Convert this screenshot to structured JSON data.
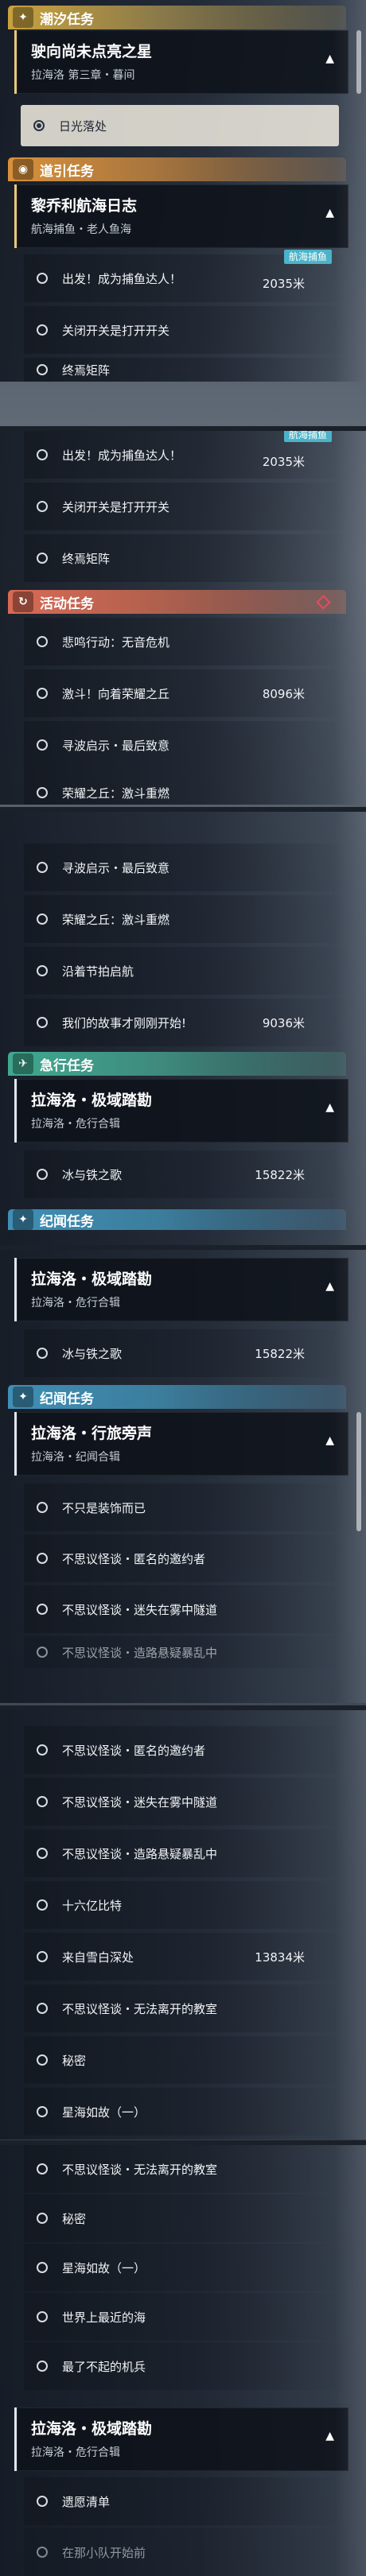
{
  "cats": {
    "chaoxi": "潮汐任务",
    "daoyin": "道引任务",
    "huodong": "活动任务",
    "jixing": "急行任务",
    "jiwen": "纪闻任务"
  },
  "cards": {
    "c1": {
      "title": "驶向尚未点亮之星",
      "sub": "拉海洛 第三章・暮间"
    },
    "c2": {
      "title": "黎乔利航海日志",
      "sub": "航海捕鱼・老人鱼海"
    },
    "c3": {
      "title": "拉海洛・极域踏勘",
      "sub": "拉海洛・危行合辑"
    },
    "c4": {
      "title": "拉海洛・极域踏勘",
      "sub": "拉海洛・危行合辑"
    },
    "c5": {
      "title": "拉海洛・行旅旁声",
      "sub": "拉海洛・纪闻合辑"
    },
    "c6": {
      "title": "拉海洛・极域踏勘",
      "sub": "拉海洛・危行合辑"
    }
  },
  "badges": {
    "hanghai": "航海捕鱼"
  },
  "rows": {
    "riguang": "日光落处",
    "chufa": "出发！成为捕鱼达人！",
    "chufa_dist": "2035米",
    "guanbi": "关闭开关是打开开关",
    "zhongyan": "终焉矩阵",
    "beiming": "悲鸣行动：无音危机",
    "jiqiao": "激斗！向着荣耀之丘",
    "jiqiao_dist": "8096米",
    "xunbo": "寻波启示・最后致意",
    "rongyao": "荣耀之丘：激斗重燃",
    "yanzhe": "沿着节拍启航",
    "women": "我们的故事才刚刚开始!",
    "women_dist": "9036米",
    "bingyutie": "冰与铁之歌",
    "bingyutie_dist": "15822米",
    "bujin": "不只是装饰而已",
    "nimingyaoyue": "不思议怪谈・匿名的邀约者",
    "mishi": "不思议怪谈・迷失在雾中隧道",
    "zaoluxuanbao_cut": "不思议怪谈・造路悬疑暴乱中",
    "zaoluxuanbao": "不思议怪谈・造路悬疑暴乱中",
    "shiliu": "十六亿比特",
    "xueyuan": "来自雪白深处",
    "xueyuan_dist": "13834米",
    "wufa": "不思议怪谈・无法离开的教室",
    "mimi": "秘密",
    "xinghai": "星海如故（一）",
    "shijie": "世界上最近的海",
    "liaobuqi": "最了不起的机兵",
    "yiyi": "遗愿清单",
    "cut_tail": "在那小队开始前"
  }
}
